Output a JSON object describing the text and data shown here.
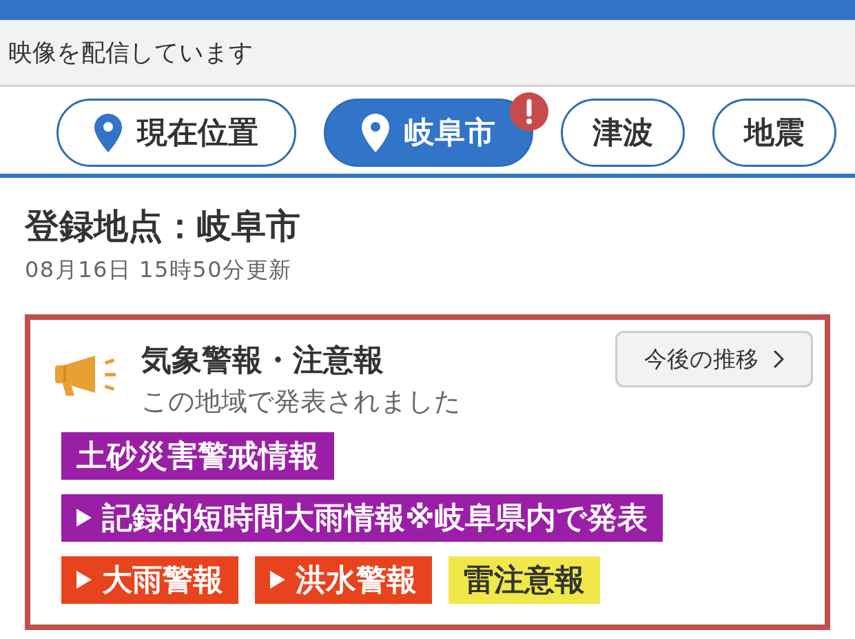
{
  "banner": {
    "text": "映像を配信しています"
  },
  "tabs": [
    {
      "label": "現在位置",
      "kind": "place",
      "selected": false,
      "alert": false
    },
    {
      "label": "岐阜市",
      "kind": "place",
      "selected": true,
      "alert": true
    },
    {
      "label": "津波",
      "kind": "topic",
      "selected": false,
      "alert": false
    },
    {
      "label": "地震",
      "kind": "topic",
      "selected": false,
      "alert": false
    }
  ],
  "location": {
    "title": "登録地点：岐阜市",
    "updated": "08月16日 15時50分更新"
  },
  "alert_card": {
    "title": "気象警報・注意報",
    "subtitle": "この地域で発表されました",
    "button": "今後の推移",
    "warnings": [
      {
        "label": "土砂災害警戒情報",
        "color": "#9a1fa6",
        "arrow": false
      },
      {
        "label": "記録的短時間大雨情報※岐阜県内で発表",
        "color": "#9a1fa6",
        "arrow": true
      },
      {
        "label": "大雨警報",
        "color": "#e8431f",
        "arrow": true
      },
      {
        "label": "洪水警報",
        "color": "#e8431f",
        "arrow": true
      },
      {
        "label": "雷注意報",
        "color": "#f0e84a",
        "arrow": false
      }
    ]
  }
}
